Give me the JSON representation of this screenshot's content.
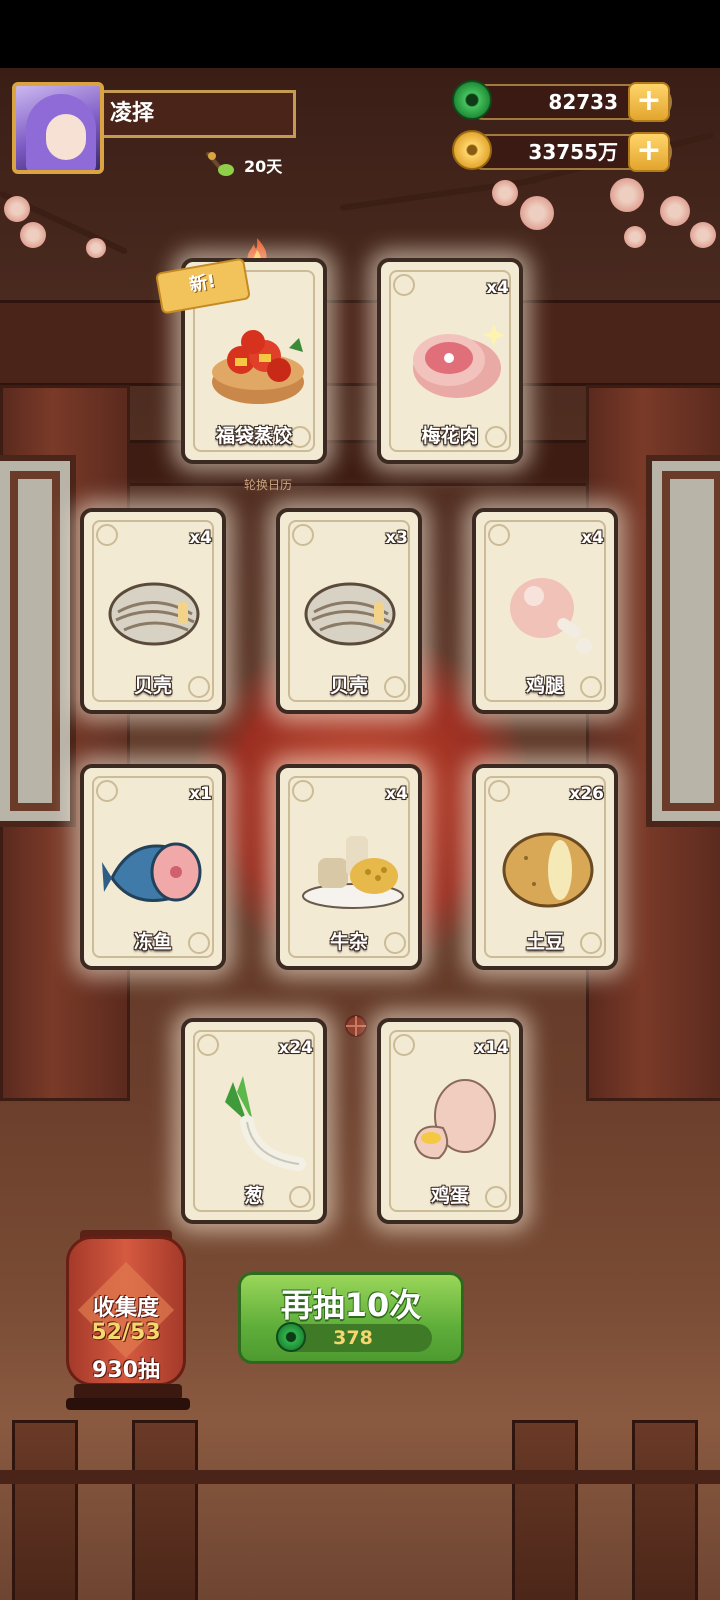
{
  "player": {
    "name": "凌择",
    "days": "20天"
  },
  "currency": {
    "jade": {
      "value": "82733",
      "icon": "jade-coin-icon"
    },
    "coins": {
      "value": "33755万",
      "icon": "gold-coin-icon"
    },
    "add_symbol": "+"
  },
  "rotate_calendar_label": "轮换日历",
  "new_badge": "新!",
  "cards": [
    {
      "name": "福袋蒸饺",
      "qty": "",
      "art": "dumpling-basket"
    },
    {
      "name": "梅花肉",
      "qty": "x4",
      "art": "pork-shoulder"
    },
    {
      "name": "贝壳",
      "qty": "x4",
      "art": "clam"
    },
    {
      "name": "贝壳",
      "qty": "x3",
      "art": "clam"
    },
    {
      "name": "鸡腿",
      "qty": "x4",
      "art": "drumstick"
    },
    {
      "name": "冻鱼",
      "qty": "x1",
      "art": "frozen-fish"
    },
    {
      "name": "牛杂",
      "qty": "x4",
      "art": "beef-offal"
    },
    {
      "name": "土豆",
      "qty": "x26",
      "art": "potato"
    },
    {
      "name": "葱",
      "qty": "x24",
      "art": "scallion"
    },
    {
      "name": "鸡蛋",
      "qty": "x14",
      "art": "egg"
    }
  ],
  "collection": {
    "title": "收集度",
    "progress": "52/53",
    "draws": "930抽"
  },
  "draw_again": {
    "label": "再抽10次",
    "cost": "378"
  },
  "colors": {
    "green_button": "#5fae3a",
    "gold": "#f5d76e",
    "card_bg": "#f3ead3"
  }
}
